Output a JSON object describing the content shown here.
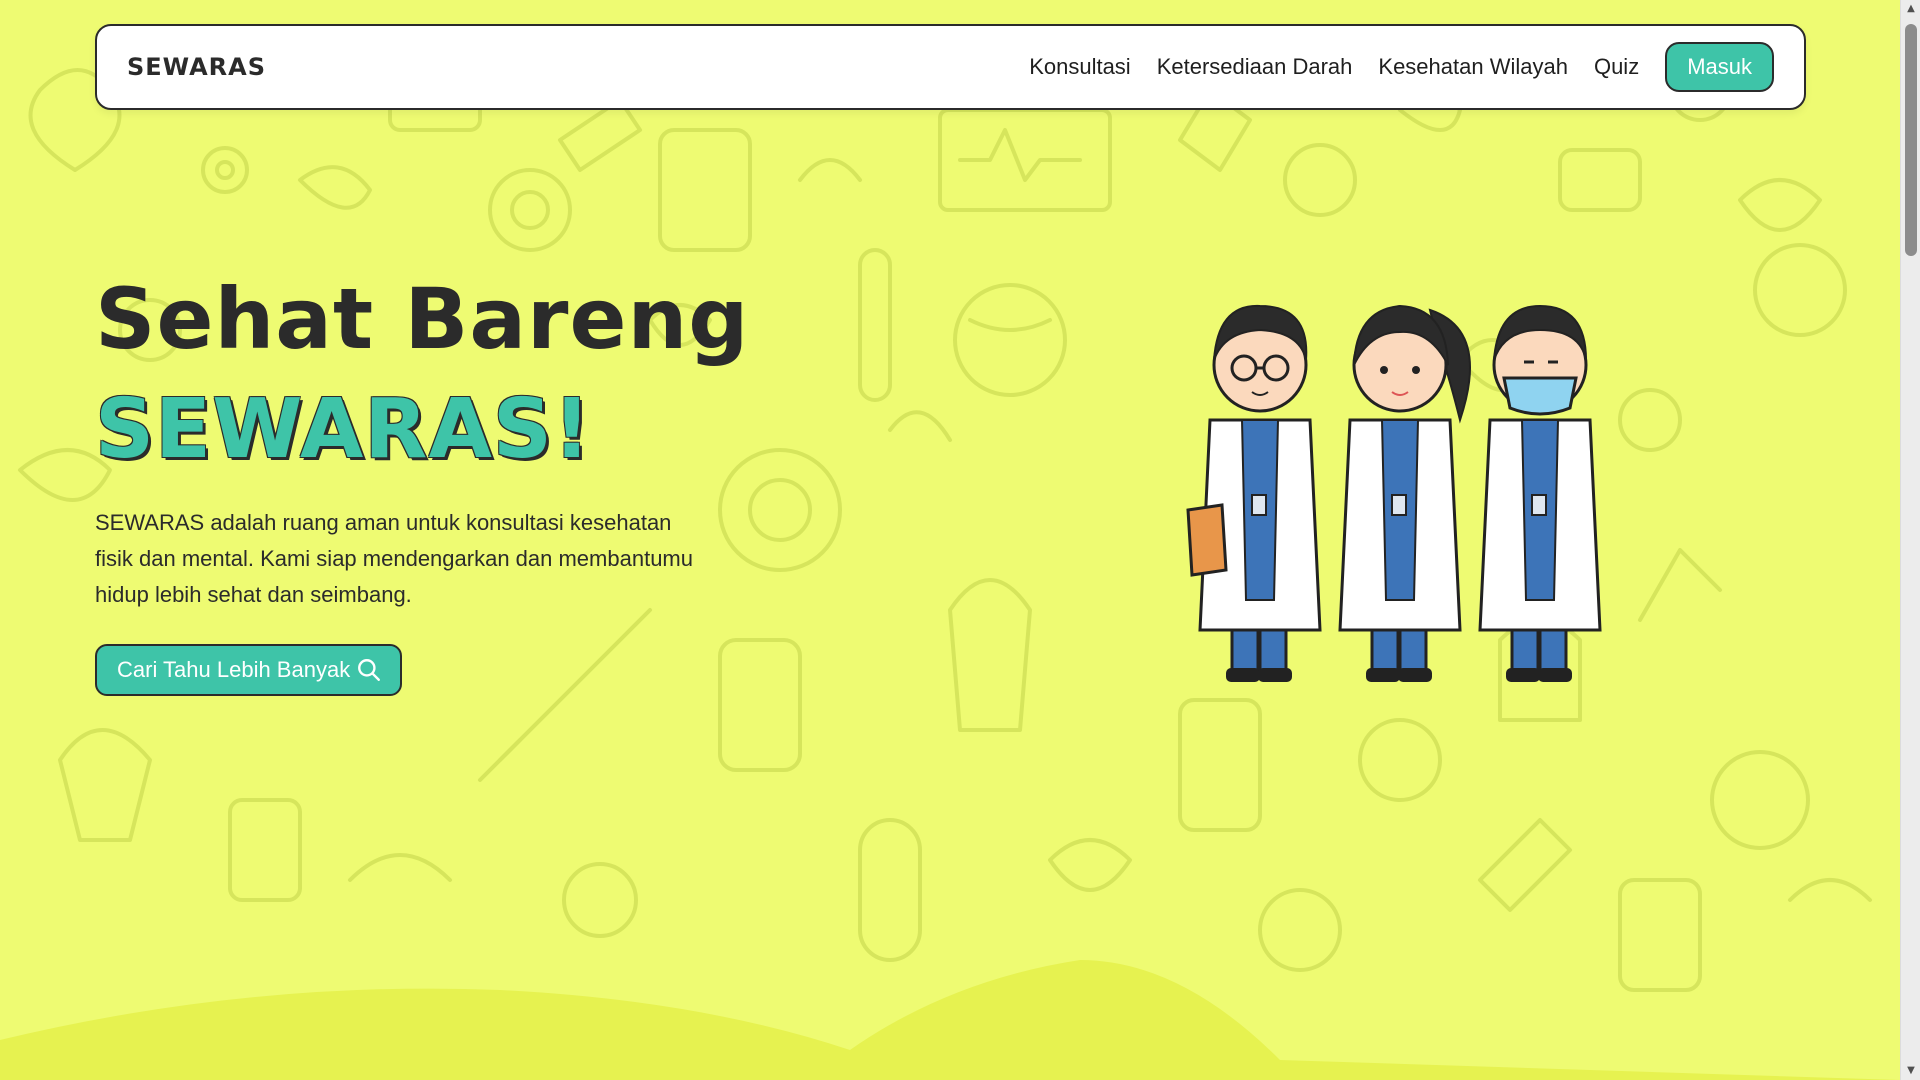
{
  "navbar": {
    "brand": "SEWARAS",
    "links": [
      "Konsultasi",
      "Ketersediaan Darah",
      "Kesehatan Wilayah",
      "Quiz"
    ],
    "login_label": "Masuk"
  },
  "hero": {
    "title_line1": "Sehat Bareng",
    "title_line2": "SEWARAS!",
    "description": "SEWARAS adalah ruang aman untuk konsultasi kesehatan fisik dan mental. Kami siap mendengarkan dan membantumu hidup lebih sehat dan seimbang.",
    "cta_label": "Cari Tahu Lebih Banyak",
    "cta_icon": "search-icon",
    "illustration": "three-doctors-illustration"
  },
  "colors": {
    "background": "#eefb72",
    "accent": "#3ec4a8",
    "text": "#2b2b2b",
    "wave": "#e6f250"
  }
}
